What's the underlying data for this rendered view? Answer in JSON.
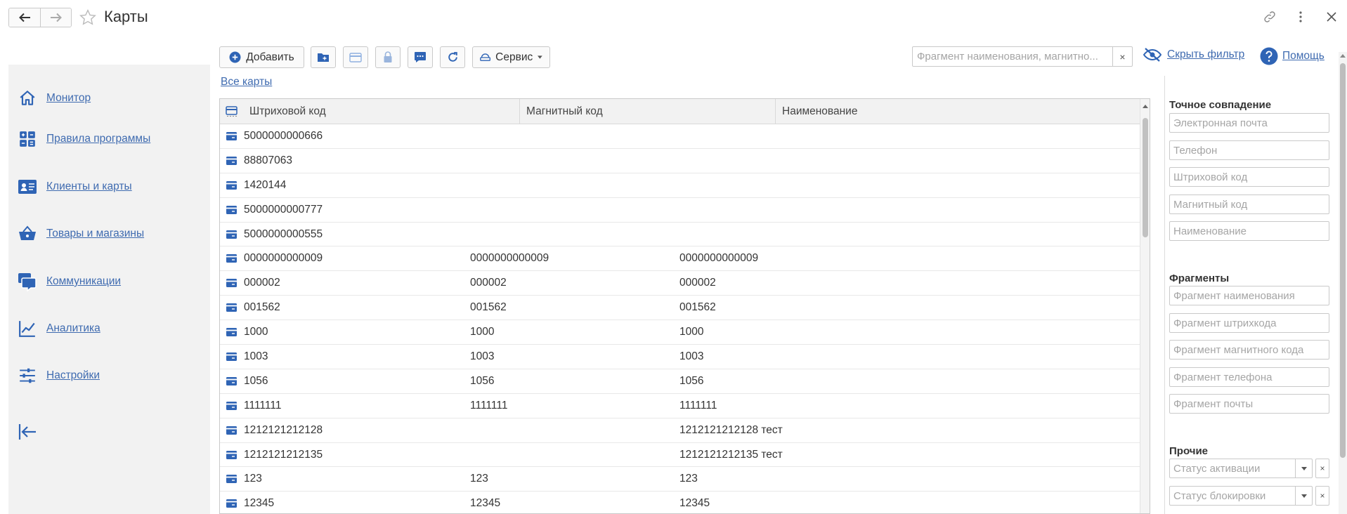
{
  "header": {
    "back_icon": "arrow-left-icon",
    "forward_icon": "arrow-right-icon",
    "favorite_icon": "star-outline-icon",
    "title": "Карты",
    "link_icon": "link-icon",
    "menu_icon": "more-vertical-icon",
    "close_icon": "close-icon"
  },
  "sidebar": {
    "items": [
      {
        "label": "Монитор",
        "icon": "home-icon"
      },
      {
        "label": "Правила программы",
        "icon": "dashboard-grid-icon"
      },
      {
        "label": "Клиенты и карты",
        "icon": "id-card-icon"
      },
      {
        "label": "Товары и магазины",
        "icon": "basket-icon"
      },
      {
        "label": "Коммуникации",
        "icon": "chat-bubbles-icon"
      },
      {
        "label": "Аналитика",
        "icon": "line-chart-icon"
      },
      {
        "label": "Настройки",
        "icon": "sliders-icon"
      }
    ],
    "collapse_icon": "collapse-panel-icon"
  },
  "toolbar": {
    "add_label": "Добавить",
    "add_icon": "plus-circle-icon",
    "service_label": "Сервис",
    "service_icon": "service-icon"
  },
  "search": {
    "placeholder": "Фрагмент наименования, магнитно...",
    "clear": "×"
  },
  "hide_filter_label": "Скрыть фильтр",
  "hide_filter_icon": "eye-off-icon",
  "help_label": "Помощь",
  "help_icon": "help-circle-icon",
  "all_cards_link": "Все карты",
  "table": {
    "columns": [
      "Штриховой код",
      "Магнитный код",
      "Наименование"
    ],
    "rows": [
      [
        "5000000000666",
        "",
        ""
      ],
      [
        "88807063",
        "",
        ""
      ],
      [
        "1420144",
        "",
        ""
      ],
      [
        "5000000000777",
        "",
        ""
      ],
      [
        "5000000000555",
        "",
        ""
      ],
      [
        "0000000000009",
        "0000000000009",
        "0000000000009"
      ],
      [
        "000002",
        "000002",
        "000002"
      ],
      [
        "001562",
        "001562",
        "001562"
      ],
      [
        "1000",
        "1000",
        "1000"
      ],
      [
        "1003",
        "1003",
        "1003"
      ],
      [
        "1056",
        "1056",
        "1056"
      ],
      [
        "1111111",
        "1111111",
        "1111111"
      ],
      [
        "1212121212128",
        "",
        "1212121212128 тест"
      ],
      [
        "1212121212135",
        "",
        "1212121212135 тест"
      ],
      [
        "123",
        "123",
        "123"
      ],
      [
        "12345",
        "12345",
        "12345"
      ]
    ]
  },
  "filters": {
    "exact_title": "Точное совпадение",
    "exact": [
      "Электронная почта",
      "Телефон",
      "Штриховой код",
      "Магнитный код",
      "Наименование"
    ],
    "fragments_title": "Фрагменты",
    "fragments": [
      "Фрагмент наименования",
      "Фрагмент штрихкода",
      "Фрагмент магнитного кода",
      "Фрагмент телефона",
      "Фрагмент почты"
    ],
    "other_title": "Прочие",
    "other": [
      "Статус активации",
      "Статус блокировки"
    ],
    "clear": "×"
  },
  "colors": {
    "link": "#3f6bb0",
    "icon_blue": "#2f64b5",
    "sidebar_bg": "#f2f2f2"
  }
}
